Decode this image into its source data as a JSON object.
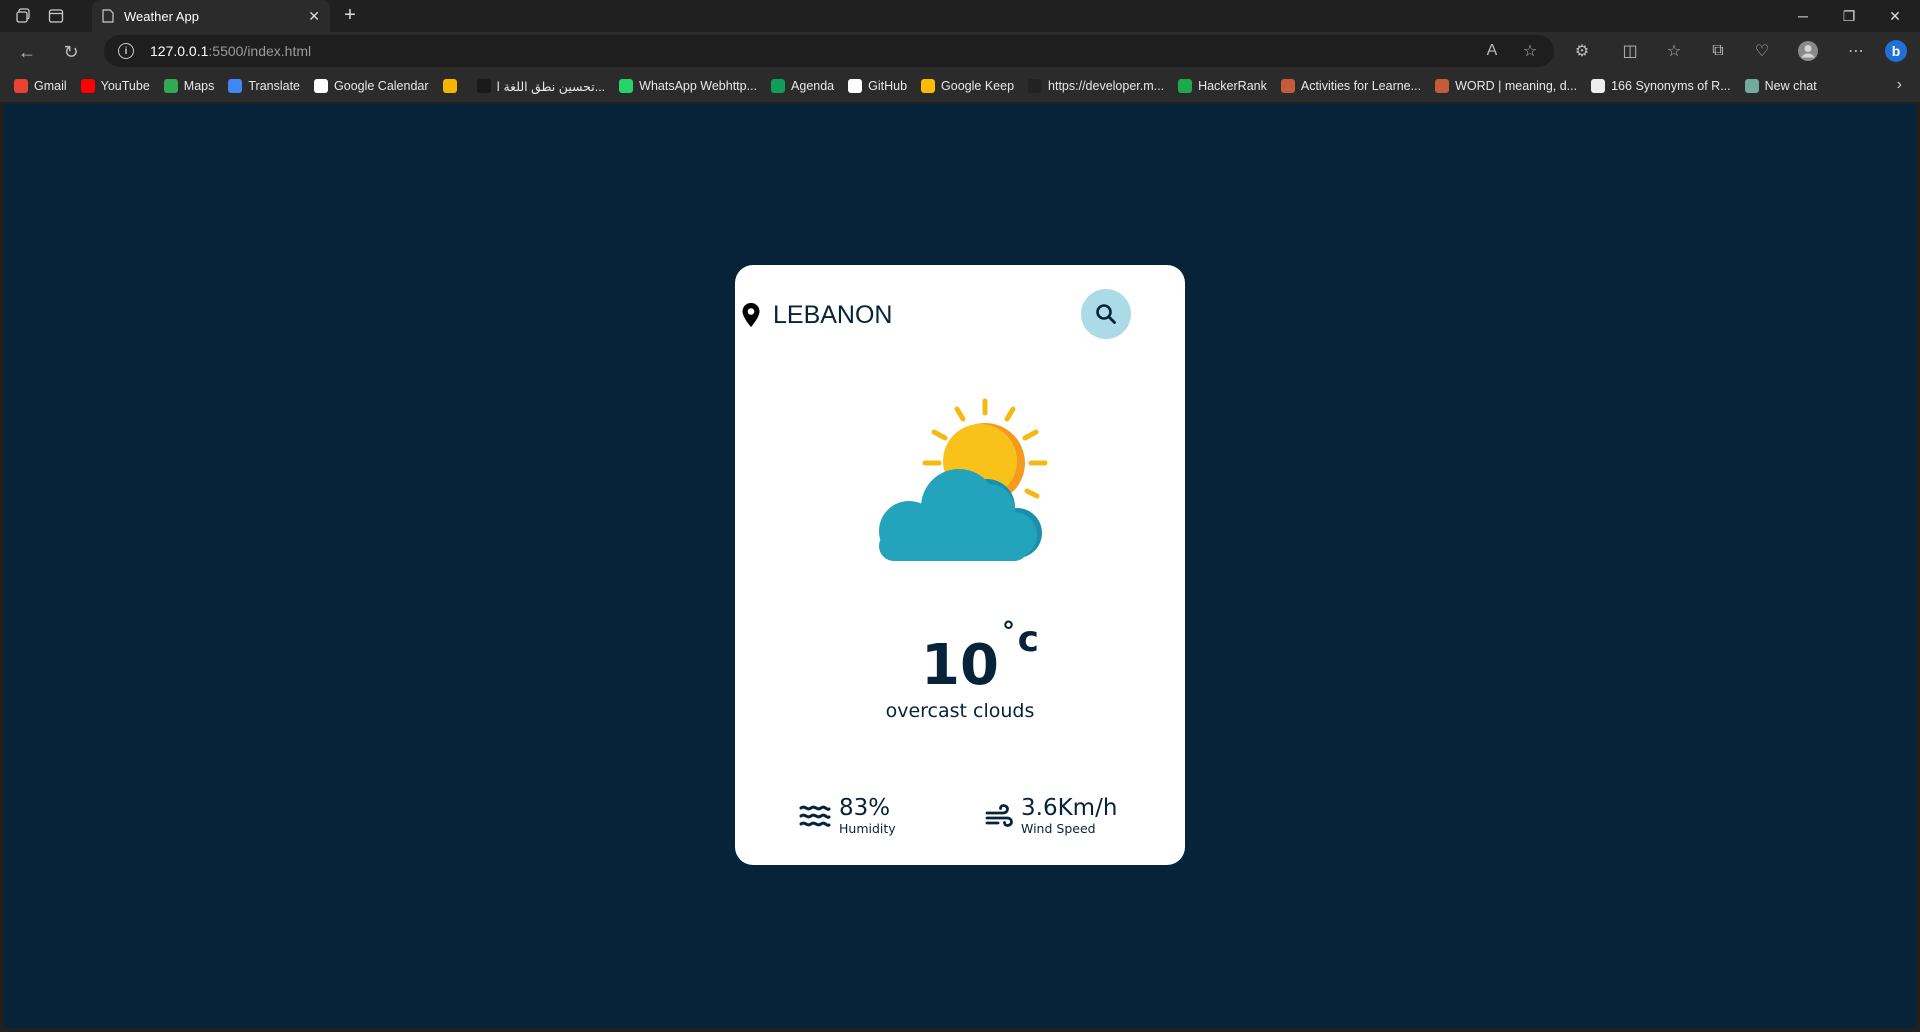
{
  "browser": {
    "tab_title": "Weather App",
    "url_host": "127.0.0.1",
    "url_rest": ":5500/index.html"
  },
  "bookmarks": [
    {
      "label": "Gmail",
      "color": "#ea4335"
    },
    {
      "label": "YouTube",
      "color": "#ff0000"
    },
    {
      "label": "Maps",
      "color": "#34a853"
    },
    {
      "label": "Translate",
      "color": "#4285f4"
    },
    {
      "label": "Google Calendar",
      "color": "#ffffff"
    },
    {
      "label": "",
      "color": "#f4b400"
    },
    {
      "label": "تحسين نطق اللغة ا...",
      "color": "#1a1a1a"
    },
    {
      "label": "WhatsApp Webhttp...",
      "color": "#25d366"
    },
    {
      "label": "Agenda",
      "color": "#0f9d58"
    },
    {
      "label": "GitHub",
      "color": "#ffffff"
    },
    {
      "label": "Google Keep",
      "color": "#fbbc04"
    },
    {
      "label": "https://developer.m...",
      "color": "#222222"
    },
    {
      "label": "HackerRank",
      "color": "#1ba94c"
    },
    {
      "label": "Activities for Learne...",
      "color": "#c45c3c"
    },
    {
      "label": "WORD | meaning, d...",
      "color": "#c45c3c"
    },
    {
      "label": "166 Synonyms of R...",
      "color": "#eeeeee"
    },
    {
      "label": "New chat",
      "color": "#74aa9c"
    }
  ],
  "app": {
    "location": "LEBANON",
    "temperature": "10",
    "degree_symbol": "°",
    "unit": "c",
    "description": "overcast clouds",
    "humidity_value": "83%",
    "humidity_label": "Humidity",
    "wind_value": "3.6Km/h",
    "wind_label": "Wind Speed",
    "background_color": "#06233a",
    "search_button_color": "#abdbe6"
  },
  "icons": {
    "location": "location-pin-icon",
    "search": "search-icon",
    "weather": "sun-cloud-icon",
    "humidity": "water-waves-icon",
    "wind": "wind-icon"
  }
}
